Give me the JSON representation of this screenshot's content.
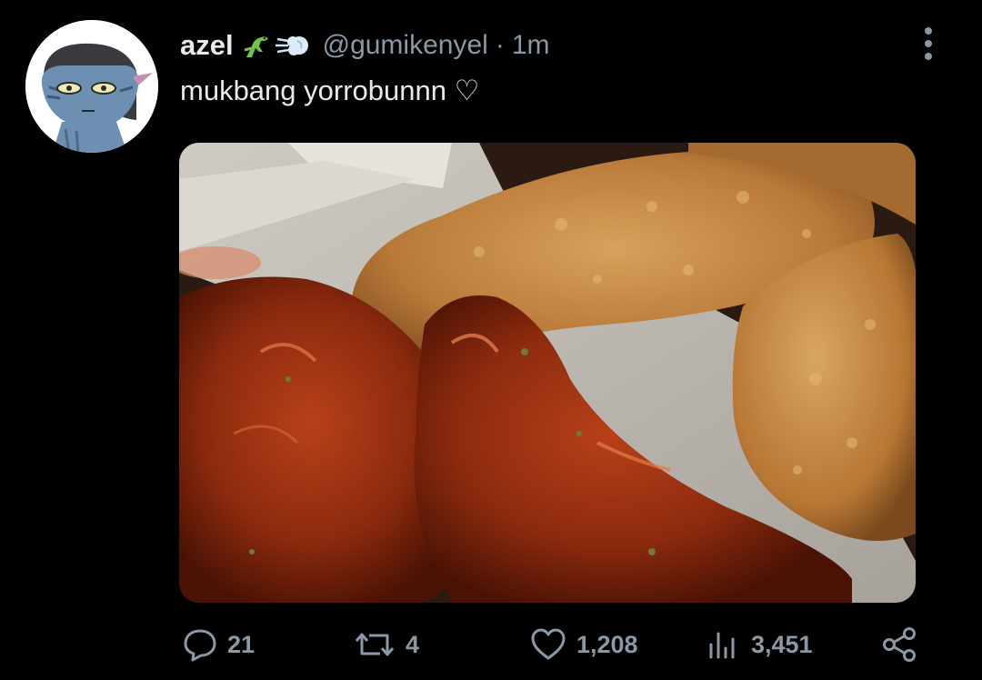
{
  "tweet": {
    "display_name": "azel",
    "handle": "@gumikenyel",
    "separator": "·",
    "time": "1m",
    "text": "mukbang yorrobunnn ♡",
    "name_emojis": [
      "dinosaur-icon",
      "dash-icon"
    ]
  },
  "actions": {
    "reply_count": "21",
    "retweet_count": "4",
    "like_count": "1,208",
    "views_count": "3,451"
  },
  "colors": {
    "background": "#000000",
    "text_primary": "#e7e9ea",
    "text_secondary": "#8b98a5"
  }
}
